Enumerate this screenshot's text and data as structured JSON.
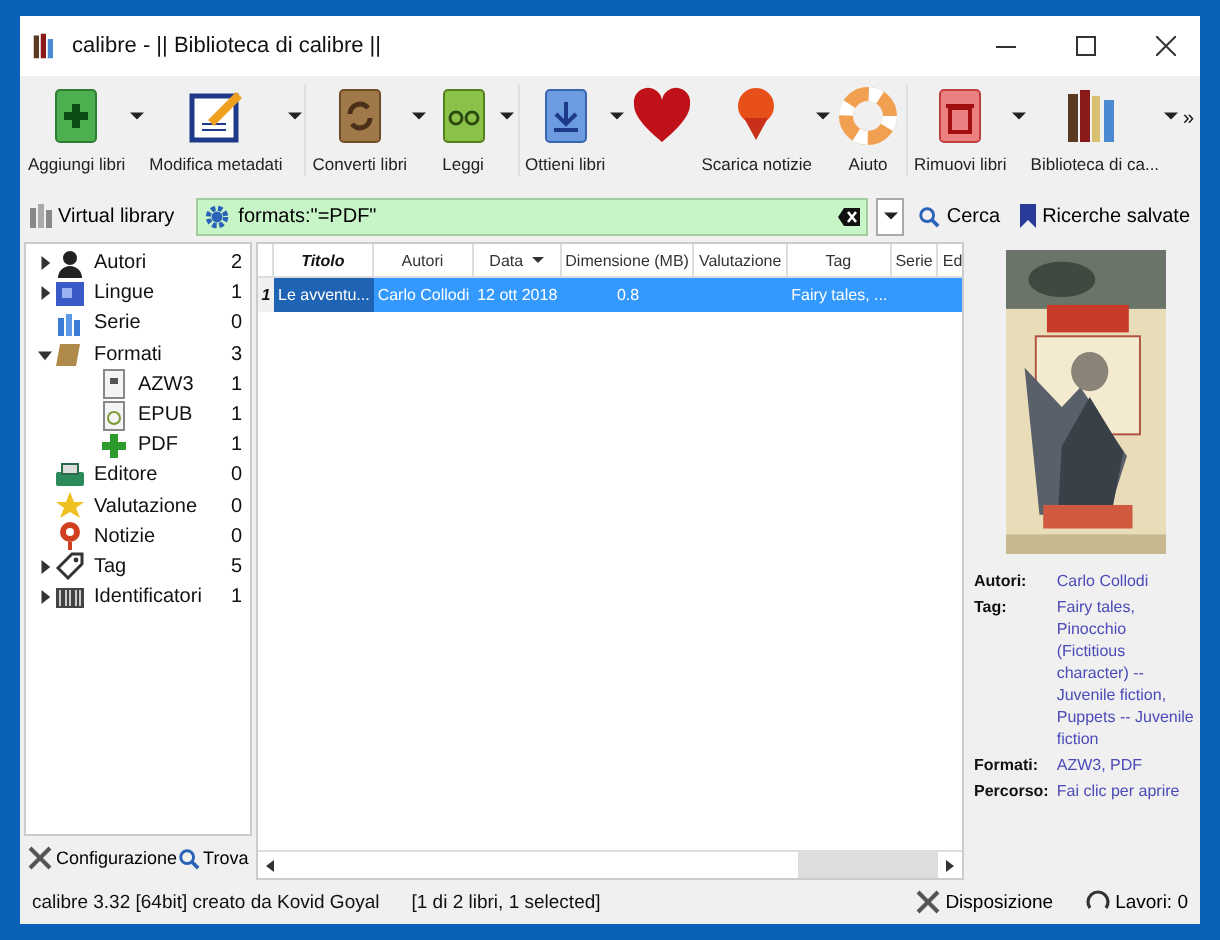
{
  "window": {
    "title": "calibre - || Biblioteca di calibre ||"
  },
  "toolbar": [
    {
      "label": "Aggiungi libri",
      "dropdown": true
    },
    {
      "label": "Modifica metadati",
      "dropdown": true
    },
    {
      "label": "Converti libri",
      "dropdown": true
    },
    {
      "label": "Leggi",
      "dropdown": true
    },
    {
      "label": "Ottieni libri",
      "dropdown": true
    },
    {
      "dropdown": false
    },
    {
      "label": "Scarica notizie",
      "dropdown": true
    },
    {
      "label": "Aiuto",
      "dropdown": false
    },
    {
      "label": "Rimuovi libri",
      "dropdown": true
    },
    {
      "label": "Biblioteca di ca...",
      "dropdown": true
    }
  ],
  "toolbar_overflow": "»",
  "search_bar": {
    "virtual_library": "Virtual library",
    "query": "formats:\"=PDF\"",
    "search": "Cerca",
    "saved_searches": "Ricerche salvate"
  },
  "tag_browser": {
    "items": [
      {
        "label": "Autori",
        "count": "2",
        "expanded": false
      },
      {
        "label": "Lingue",
        "count": "1",
        "expanded": false
      },
      {
        "label": "Serie",
        "count": "0"
      },
      {
        "label": "Formati",
        "count": "3",
        "expanded": true,
        "children": [
          {
            "label": "AZW3",
            "count": "1"
          },
          {
            "label": "EPUB",
            "count": "1"
          },
          {
            "label": "PDF",
            "count": "1"
          }
        ]
      },
      {
        "label": "Editore",
        "count": "0"
      },
      {
        "label": "Valutazione",
        "count": "0"
      },
      {
        "label": "Notizie",
        "count": "0"
      },
      {
        "label": "Tag",
        "count": "5",
        "expanded": false
      },
      {
        "label": "Identificatori",
        "count": "1",
        "expanded": false
      }
    ],
    "configure": "Configurazione",
    "find": "Trova"
  },
  "book_list": {
    "columns": [
      {
        "label": "Titolo",
        "sorted": true,
        "menu": false
      },
      {
        "label": "Autori",
        "sorted": false,
        "menu": false
      },
      {
        "label": "Data",
        "sorted": false,
        "menu": true
      },
      {
        "label": "Dimensione (MB)",
        "sorted": false,
        "menu": false
      },
      {
        "label": "Valutazione",
        "sorted": false,
        "menu": false
      },
      {
        "label": "Tag",
        "sorted": false,
        "menu": false
      },
      {
        "label": "Serie",
        "sorted": false,
        "menu": false
      },
      {
        "label": "Ed",
        "sorted": false,
        "menu": false
      }
    ],
    "rows": [
      {
        "number": "1",
        "selected": true,
        "cells": [
          {
            "text": "Le avventu...",
            "current": true
          },
          {
            "text": "Carlo Collodi",
            "current": false
          },
          {
            "text": "12 ott 2018",
            "current": false
          },
          {
            "text": "0.8",
            "current": false
          },
          null,
          {
            "text": "Fairy tales, ...",
            "current": false
          },
          null,
          null
        ]
      }
    ]
  },
  "book_details": {
    "fields": [
      {
        "label": "Autori:",
        "value": "Carlo Collodi"
      },
      {
        "label": "Tag:",
        "value": "Fairy tales, Pinocchio (Fictitious character) -- Juvenile fiction, Puppets -- Juvenile fiction"
      },
      {
        "label": "Formati:",
        "value": "AZW3, PDF"
      },
      {
        "label": "Percorso:",
        "value": "Fai clic per aprire"
      }
    ]
  },
  "status_bar": {
    "version": "calibre 3.32 [64bit] creato da Kovid Goyal",
    "selection": "[1 di 2 libri, 1 selected]",
    "layout": "Disposizione",
    "jobs": "Lavori: 0"
  }
}
